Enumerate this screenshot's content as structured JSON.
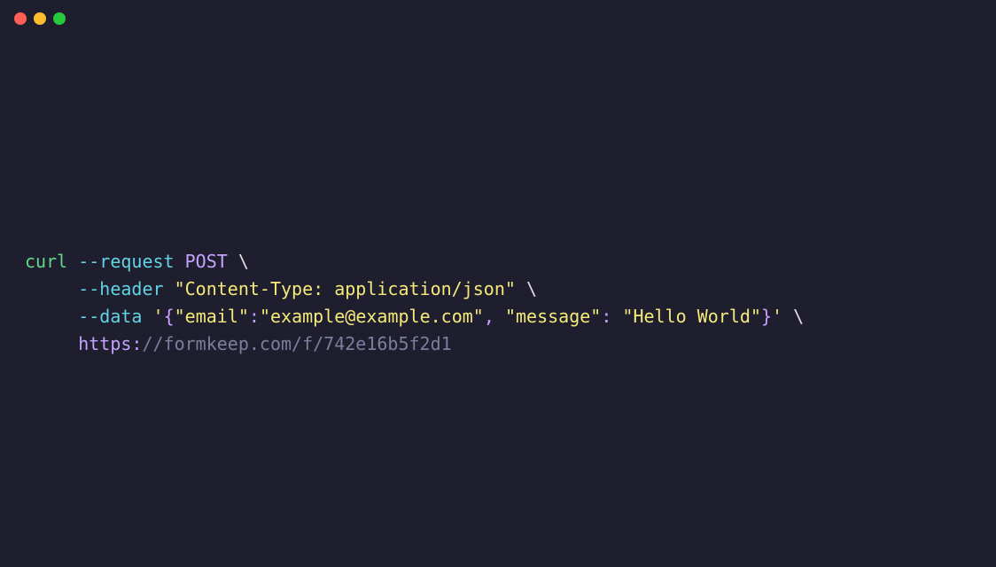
{
  "titlebar": {
    "close_icon": "close",
    "minimize_icon": "minimize",
    "maximize_icon": "maximize"
  },
  "code": {
    "line1": {
      "cmd": "curl",
      "sp1": " ",
      "flag": "--request",
      "sp2": " ",
      "method": "POST",
      "sp3": " ",
      "cont": "\\"
    },
    "line2": {
      "indent": "     ",
      "flag": "--header",
      "sp1": " ",
      "q1": "\"",
      "str": "Content-Type: application/json",
      "q2": "\"",
      "sp2": " ",
      "cont": "\\"
    },
    "line3": {
      "indent": "     ",
      "flag": "--data",
      "sp1": " ",
      "sq1": "'",
      "cb1": "{",
      "q1": "\"",
      "key1": "email",
      "q2": "\"",
      "colon1": ":",
      "q3": "\"",
      "val1": "example@example.com",
      "q4": "\"",
      "comma": ",",
      "sp2": " ",
      "q5": "\"",
      "key2": "message",
      "q6": "\"",
      "colon2": ":",
      "sp3": " ",
      "q7": "\"",
      "val2": "Hello World",
      "q8": "\"",
      "cb2": "}",
      "sq2": "'",
      "sp4": " ",
      "cont": "\\"
    },
    "line4": {
      "indent": "     ",
      "scheme": "https:",
      "rest": "//formkeep.com/f/742e16b5f2d1"
    }
  }
}
